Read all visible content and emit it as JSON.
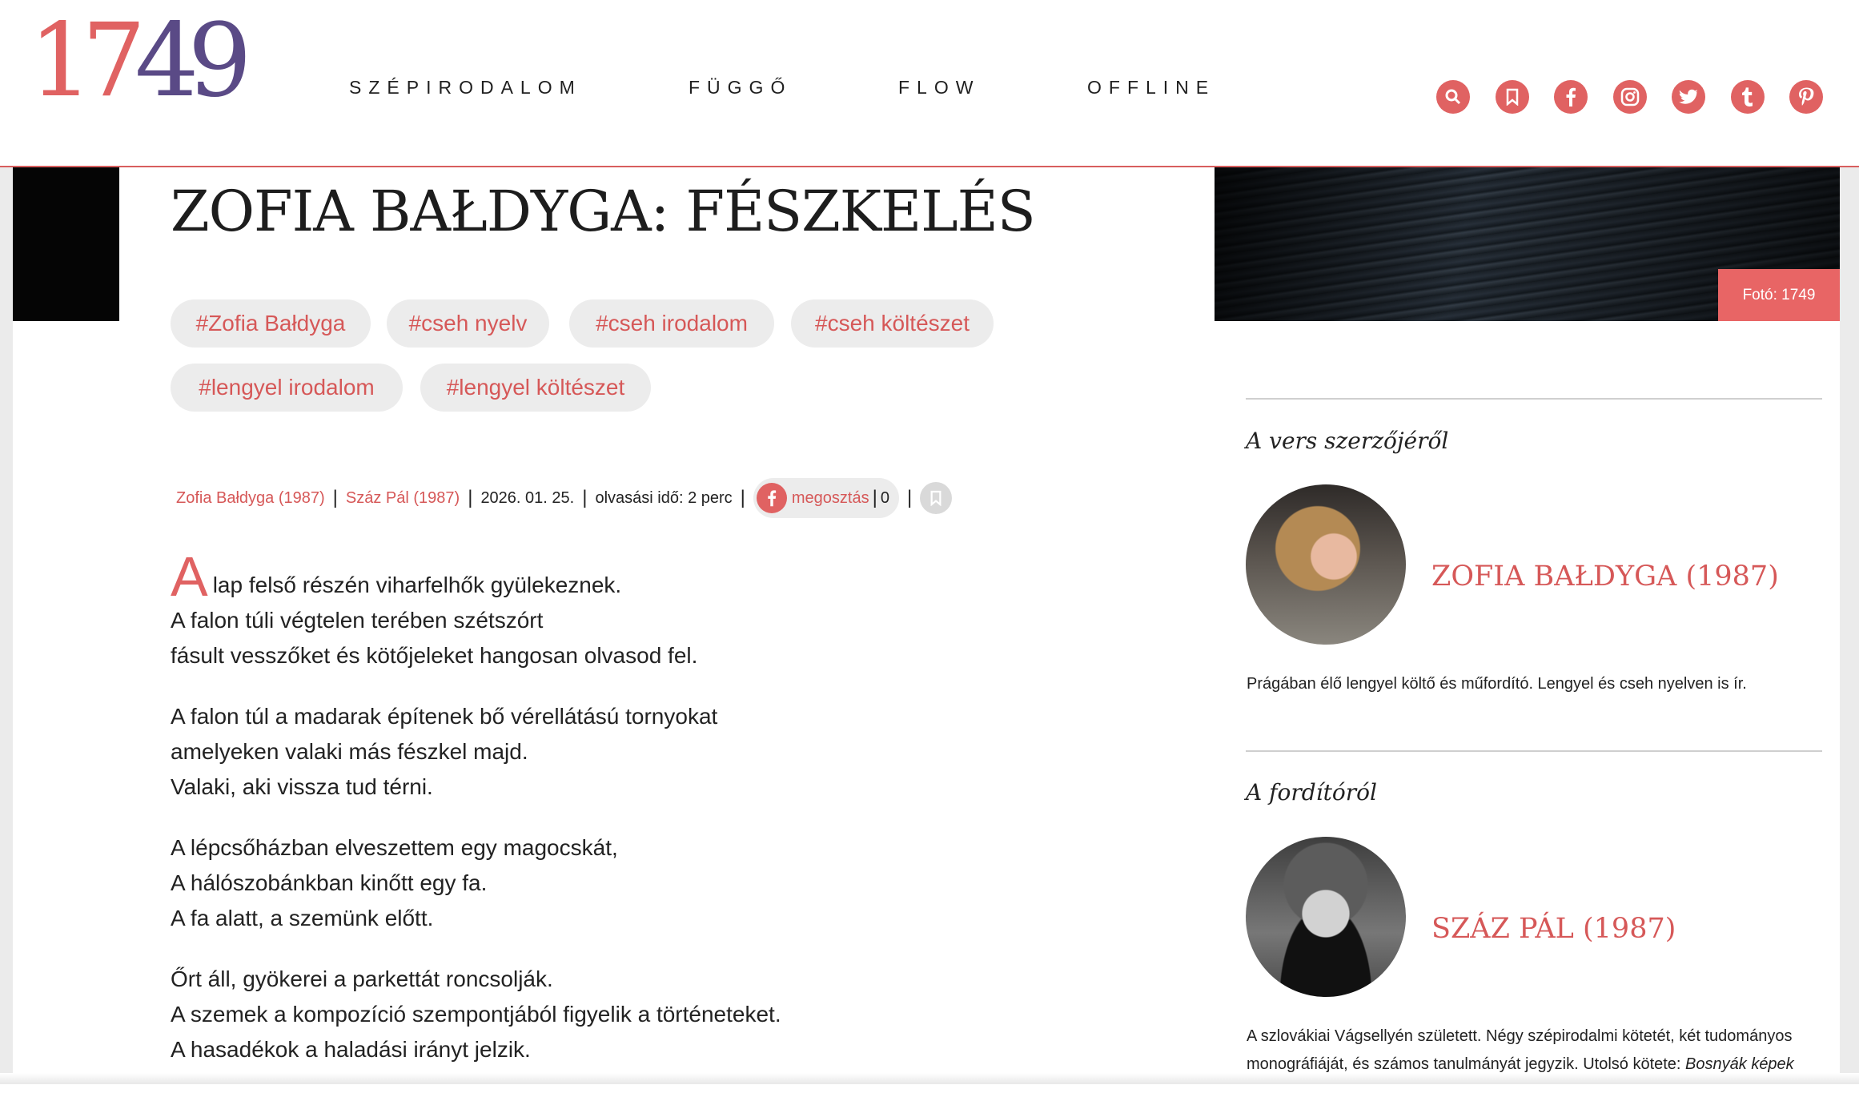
{
  "site": {
    "logo_part1": "17",
    "logo_part2": "49"
  },
  "nav": [
    "SZÉPIRODALOM",
    "FÜGGŐ",
    "FLOW",
    "OFFLINE"
  ],
  "header_icons": [
    "search-icon",
    "bookmark-icon",
    "facebook-icon",
    "instagram-icon",
    "twitter-icon",
    "tumblr-icon",
    "pinterest-icon"
  ],
  "accent_color": "#e06262",
  "hero": {
    "photo_credit": "Fotó: 1749"
  },
  "article": {
    "title": "ZOFIA BAŁDYGA: FÉSZKELÉS",
    "tags": [
      "#Zofia Bałdyga",
      "#cseh nyelv",
      "#cseh irodalom",
      "#cseh költészet",
      "#lengyel irodalom",
      "#lengyel költészet"
    ],
    "meta": {
      "author": "Zofia Bałdyga (1987)",
      "translator": "Száz Pál (1987)",
      "date": "2026. 01. 25.",
      "reading_time": "olvasási idő: 2 perc",
      "share_label": "megosztás",
      "share_count": "0",
      "sep": "|"
    },
    "dropcap": "A",
    "stanzas": [
      [
        "lap felső részén viharfelhők gyülekeznek.",
        "A falon túli végtelen terében szétszórt",
        "fásult vesszőket és kötőjeleket hangosan olvasod fel."
      ],
      [
        "A falon túl a madarak építenek bő vérellátású tornyokat",
        "amelyeken valaki más fészkel majd.",
        "Valaki, aki vissza tud térni."
      ],
      [
        "A lépcsőházban elveszettem egy magocskát,",
        "A hálószobánkban kinőtt egy fa.",
        "A fa alatt, a szemünk előtt."
      ],
      [
        "Őrt áll, gyökerei a parkettát roncsolják.",
        "A szemek a kompozíció szempontjából figyelik a történeteket.",
        "A hasadékok a haladási irányt jelzik."
      ]
    ]
  },
  "sidebar": {
    "author_heading": "A vers szerzőjéről",
    "author_name": "ZOFIA BAŁDYGA (1987)",
    "author_bio": "Prágában élő lengyel költő és műfordító. Lengyel és cseh nyelven is ír.",
    "translator_heading": "A fordítóról",
    "translator_name": "SZÁZ PÁL (1987)",
    "translator_bio_1": "A szlovákiai Vágsellyén született. Négy szépirodalmi kötetét, két tudományos monográfiáját, és számos tanulmányát jegyzik. Utolsó kötete: ",
    "translator_bio_italic": "Bosnyák képek"
  }
}
